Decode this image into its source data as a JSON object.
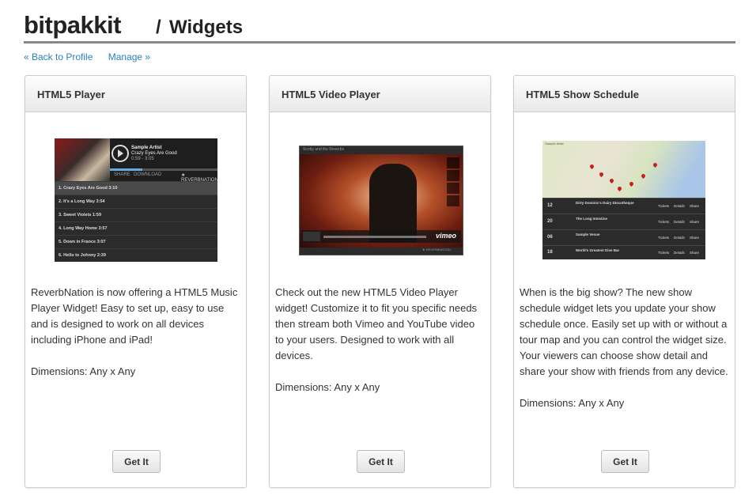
{
  "header": {
    "brand": "bitpakkit",
    "separator": "/",
    "section": "Widgets"
  },
  "subnav": {
    "back": "« Back to Profile",
    "manage": "Manage »"
  },
  "cards": [
    {
      "title": "HTML5 Player",
      "description": "ReverbNation is now offering a HTML5 Music Player Widget! Easy to set up, easy to use and is designed to work on all devices including iPhone and iPad!",
      "dimensions": "Dimensions: Any x Any",
      "button": "Get It",
      "preview": {
        "artist": "Sample Artist",
        "song": "Crazy Eyes Are Good",
        "time": "0:59 - 3:05",
        "tabs": [
          "SHARE",
          "DOWNLOAD",
          "★ REVERBNATION"
        ],
        "tracks": [
          "1. Crazy Eyes Are Good 3:10",
          "2. It's a Long Way 3:54",
          "3. Sweet Violets 1:59",
          "4. Long Way Home 3:57",
          "5. Down in France 3:07",
          "6. Hello to Johnny 2:39"
        ]
      }
    },
    {
      "title": "HTML5 Video Player",
      "description": "Check out the new HTML5 Video Player widget! Customize it to fit you specific needs then stream both Vimeo and YouTube video to your users. Designed to work with all devices.",
      "dimensions": "Dimensions: Any x Any",
      "button": "Get It",
      "preview": {
        "caption": "Scotty and the Reverbs",
        "brand": "vimeo",
        "side_buttons": [
          "LIKE",
          "LATER",
          "SHARE",
          "EMBED"
        ],
        "footer": "★ REVERBNATION"
      }
    },
    {
      "title": "HTML5 Show Schedule",
      "description": "When is the big show? The new show schedule widget lets you update your show schedule once. Easily set up with or without a tour map and you can control the widget size. Your viewers can choose show detail and share your show with friends from any device.",
      "dimensions": "Dimensions: Any x Any",
      "button": "Get It",
      "preview": {
        "title": "Sample Artist",
        "shows": [
          {
            "day": "12",
            "venue": "Dirty Dominic's Dairy Discotheque"
          },
          {
            "day": "20",
            "venue": "The Long Intestine"
          },
          {
            "day": "06",
            "venue": "Sample Venue"
          },
          {
            "day": "18",
            "venue": "World's Greatest Dive Bar"
          }
        ],
        "actions": [
          "Tickets",
          "Details",
          "Share"
        ]
      }
    }
  ]
}
